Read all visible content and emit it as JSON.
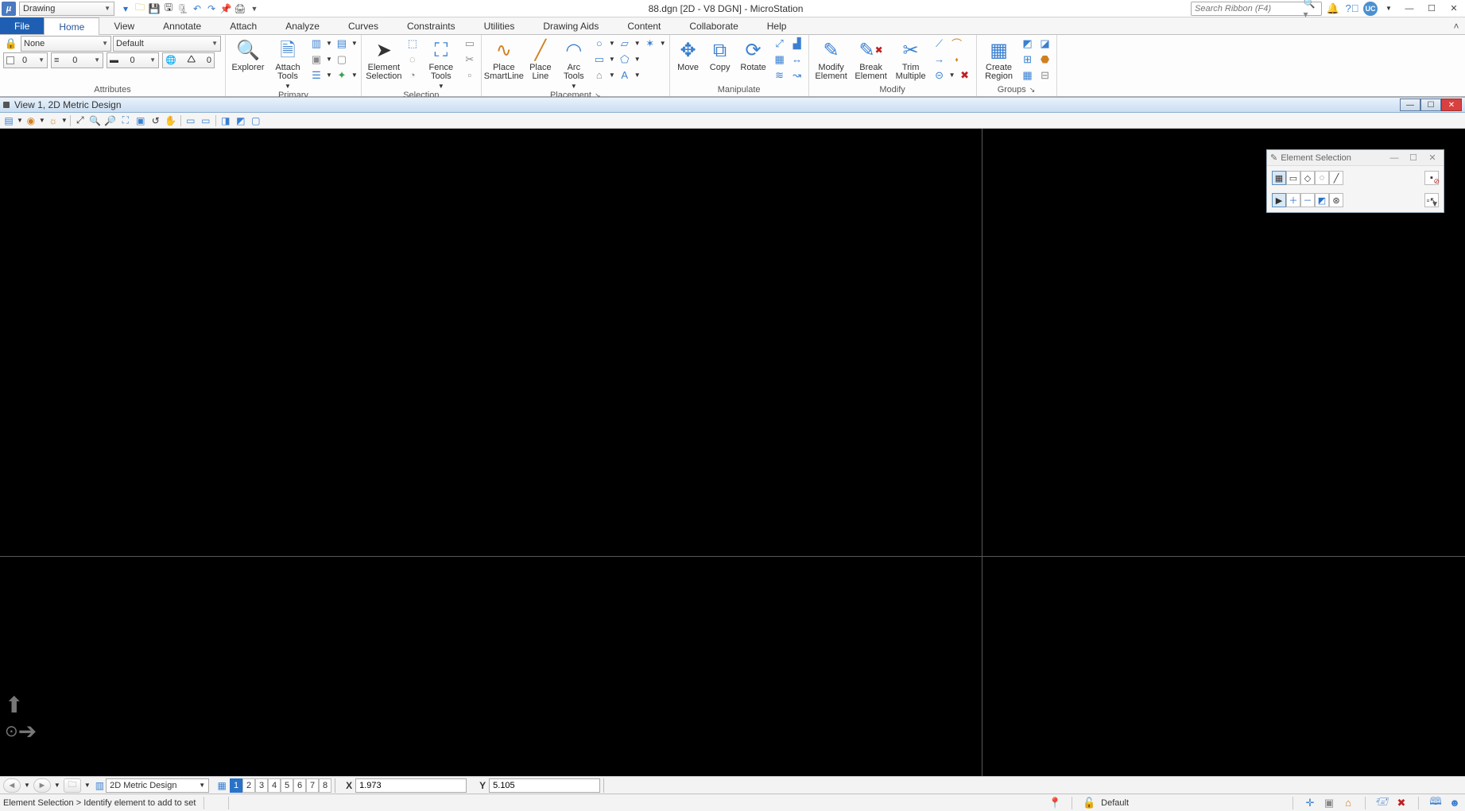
{
  "titlebar": {
    "workflow": "Drawing",
    "title": "88.dgn [2D - V8 DGN] - MicroStation",
    "search_placeholder": "Search Ribbon (F4)",
    "user_badge": "UC"
  },
  "tabs": {
    "file": "File",
    "items": [
      "Home",
      "View",
      "Annotate",
      "Attach",
      "Analyze",
      "Curves",
      "Constraints",
      "Utilities",
      "Drawing Aids",
      "Content",
      "Collaborate",
      "Help"
    ],
    "active": "Home"
  },
  "ribbon": {
    "attributes": {
      "label": "Attributes",
      "level": "None",
      "template": "Default",
      "color": "0",
      "style": "0",
      "weight": "0",
      "transparency": "0"
    },
    "primary": {
      "label": "Primary",
      "explorer": "Explorer",
      "attach": "Attach Tools"
    },
    "selection": {
      "label": "Selection",
      "elsel": "Element Selection",
      "fence": "Fence Tools"
    },
    "placement": {
      "label": "Placement",
      "smartline": "Place SmartLine",
      "line": "Place Line",
      "arc": "Arc Tools"
    },
    "manipulate": {
      "label": "Manipulate",
      "move": "Move",
      "copy": "Copy",
      "rotate": "Rotate"
    },
    "modify": {
      "label": "Modify",
      "modifyel": "Modify Element",
      "breakel": "Break Element",
      "trim": "Trim Multiple"
    },
    "groups": {
      "label": "Groups",
      "region": "Create Region"
    }
  },
  "view": {
    "title": "View 1, 2D Metric Design"
  },
  "toolsettings": {
    "title": "Element Selection"
  },
  "bottom": {
    "model": "2D Metric Design",
    "views": [
      "1",
      "2",
      "3",
      "4",
      "5",
      "6",
      "7",
      "8"
    ],
    "active_view": "1",
    "x_label": "X",
    "x_value": "1.973",
    "y_label": "Y",
    "y_value": "5.105"
  },
  "status": {
    "prompt": "Element Selection > Identify element to add to set",
    "level": "Default"
  }
}
